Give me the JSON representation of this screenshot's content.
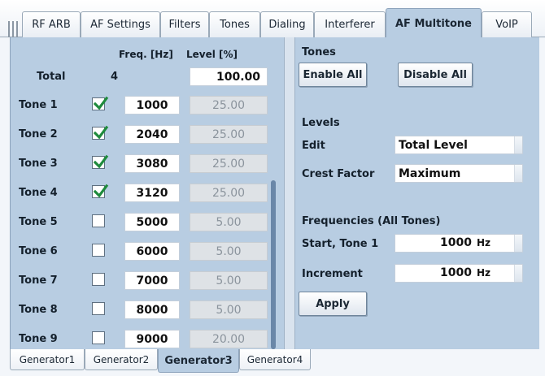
{
  "top_tabs": [
    {
      "label": "RF ARB"
    },
    {
      "label": "AF Settings"
    },
    {
      "label": "Filters"
    },
    {
      "label": "Tones"
    },
    {
      "label": "Dialing"
    },
    {
      "label": "Interferer"
    },
    {
      "label": "AF Multitone",
      "active": true
    },
    {
      "label": "VoIP"
    }
  ],
  "left": {
    "col_freq": "Freq. [Hz]",
    "col_level": "Level [%]",
    "total_label": "Total",
    "total_count": "4",
    "total_level": "100.00",
    "tones": [
      {
        "label": "Tone 1",
        "checked": true,
        "freq": "1000",
        "level": "25.00"
      },
      {
        "label": "Tone 2",
        "checked": true,
        "freq": "2040",
        "level": "25.00"
      },
      {
        "label": "Tone 3",
        "checked": true,
        "freq": "3080",
        "level": "25.00"
      },
      {
        "label": "Tone 4",
        "checked": true,
        "freq": "3120",
        "level": "25.00"
      },
      {
        "label": "Tone 5",
        "checked": false,
        "freq": "5000",
        "level": "5.00"
      },
      {
        "label": "Tone 6",
        "checked": false,
        "freq": "6000",
        "level": "5.00"
      },
      {
        "label": "Tone 7",
        "checked": false,
        "freq": "7000",
        "level": "5.00"
      },
      {
        "label": "Tone 8",
        "checked": false,
        "freq": "8000",
        "level": "5.00"
      },
      {
        "label": "Tone 9",
        "checked": false,
        "freq": "9000",
        "level": "20.00"
      }
    ]
  },
  "right": {
    "tones_heading": "Tones",
    "enable_all": "Enable All",
    "disable_all": "Disable All",
    "levels_heading": "Levels",
    "edit_label": "Edit",
    "edit_value": "Total Level",
    "crest_label": "Crest Factor",
    "crest_value": "Maximum",
    "freq_heading": "Frequencies (All Tones)",
    "start_label": "Start, Tone 1",
    "start_value": "1000",
    "start_unit": "Hz",
    "increment_label": "Increment",
    "increment_value": "1000",
    "increment_unit": "Hz",
    "apply": "Apply"
  },
  "bottom_tabs": [
    {
      "label": "Generator1"
    },
    {
      "label": "Generator2"
    },
    {
      "label": "Generator3",
      "active": true
    },
    {
      "label": "Generator4"
    }
  ],
  "colors": {
    "panel": "#b8cde2",
    "check": "#1e8a3c",
    "disabled_field": "#dee2e6"
  },
  "icons": {
    "check": "check-icon",
    "grip": "grip-icon",
    "dropdown": "dropdown-arrow-icon"
  }
}
